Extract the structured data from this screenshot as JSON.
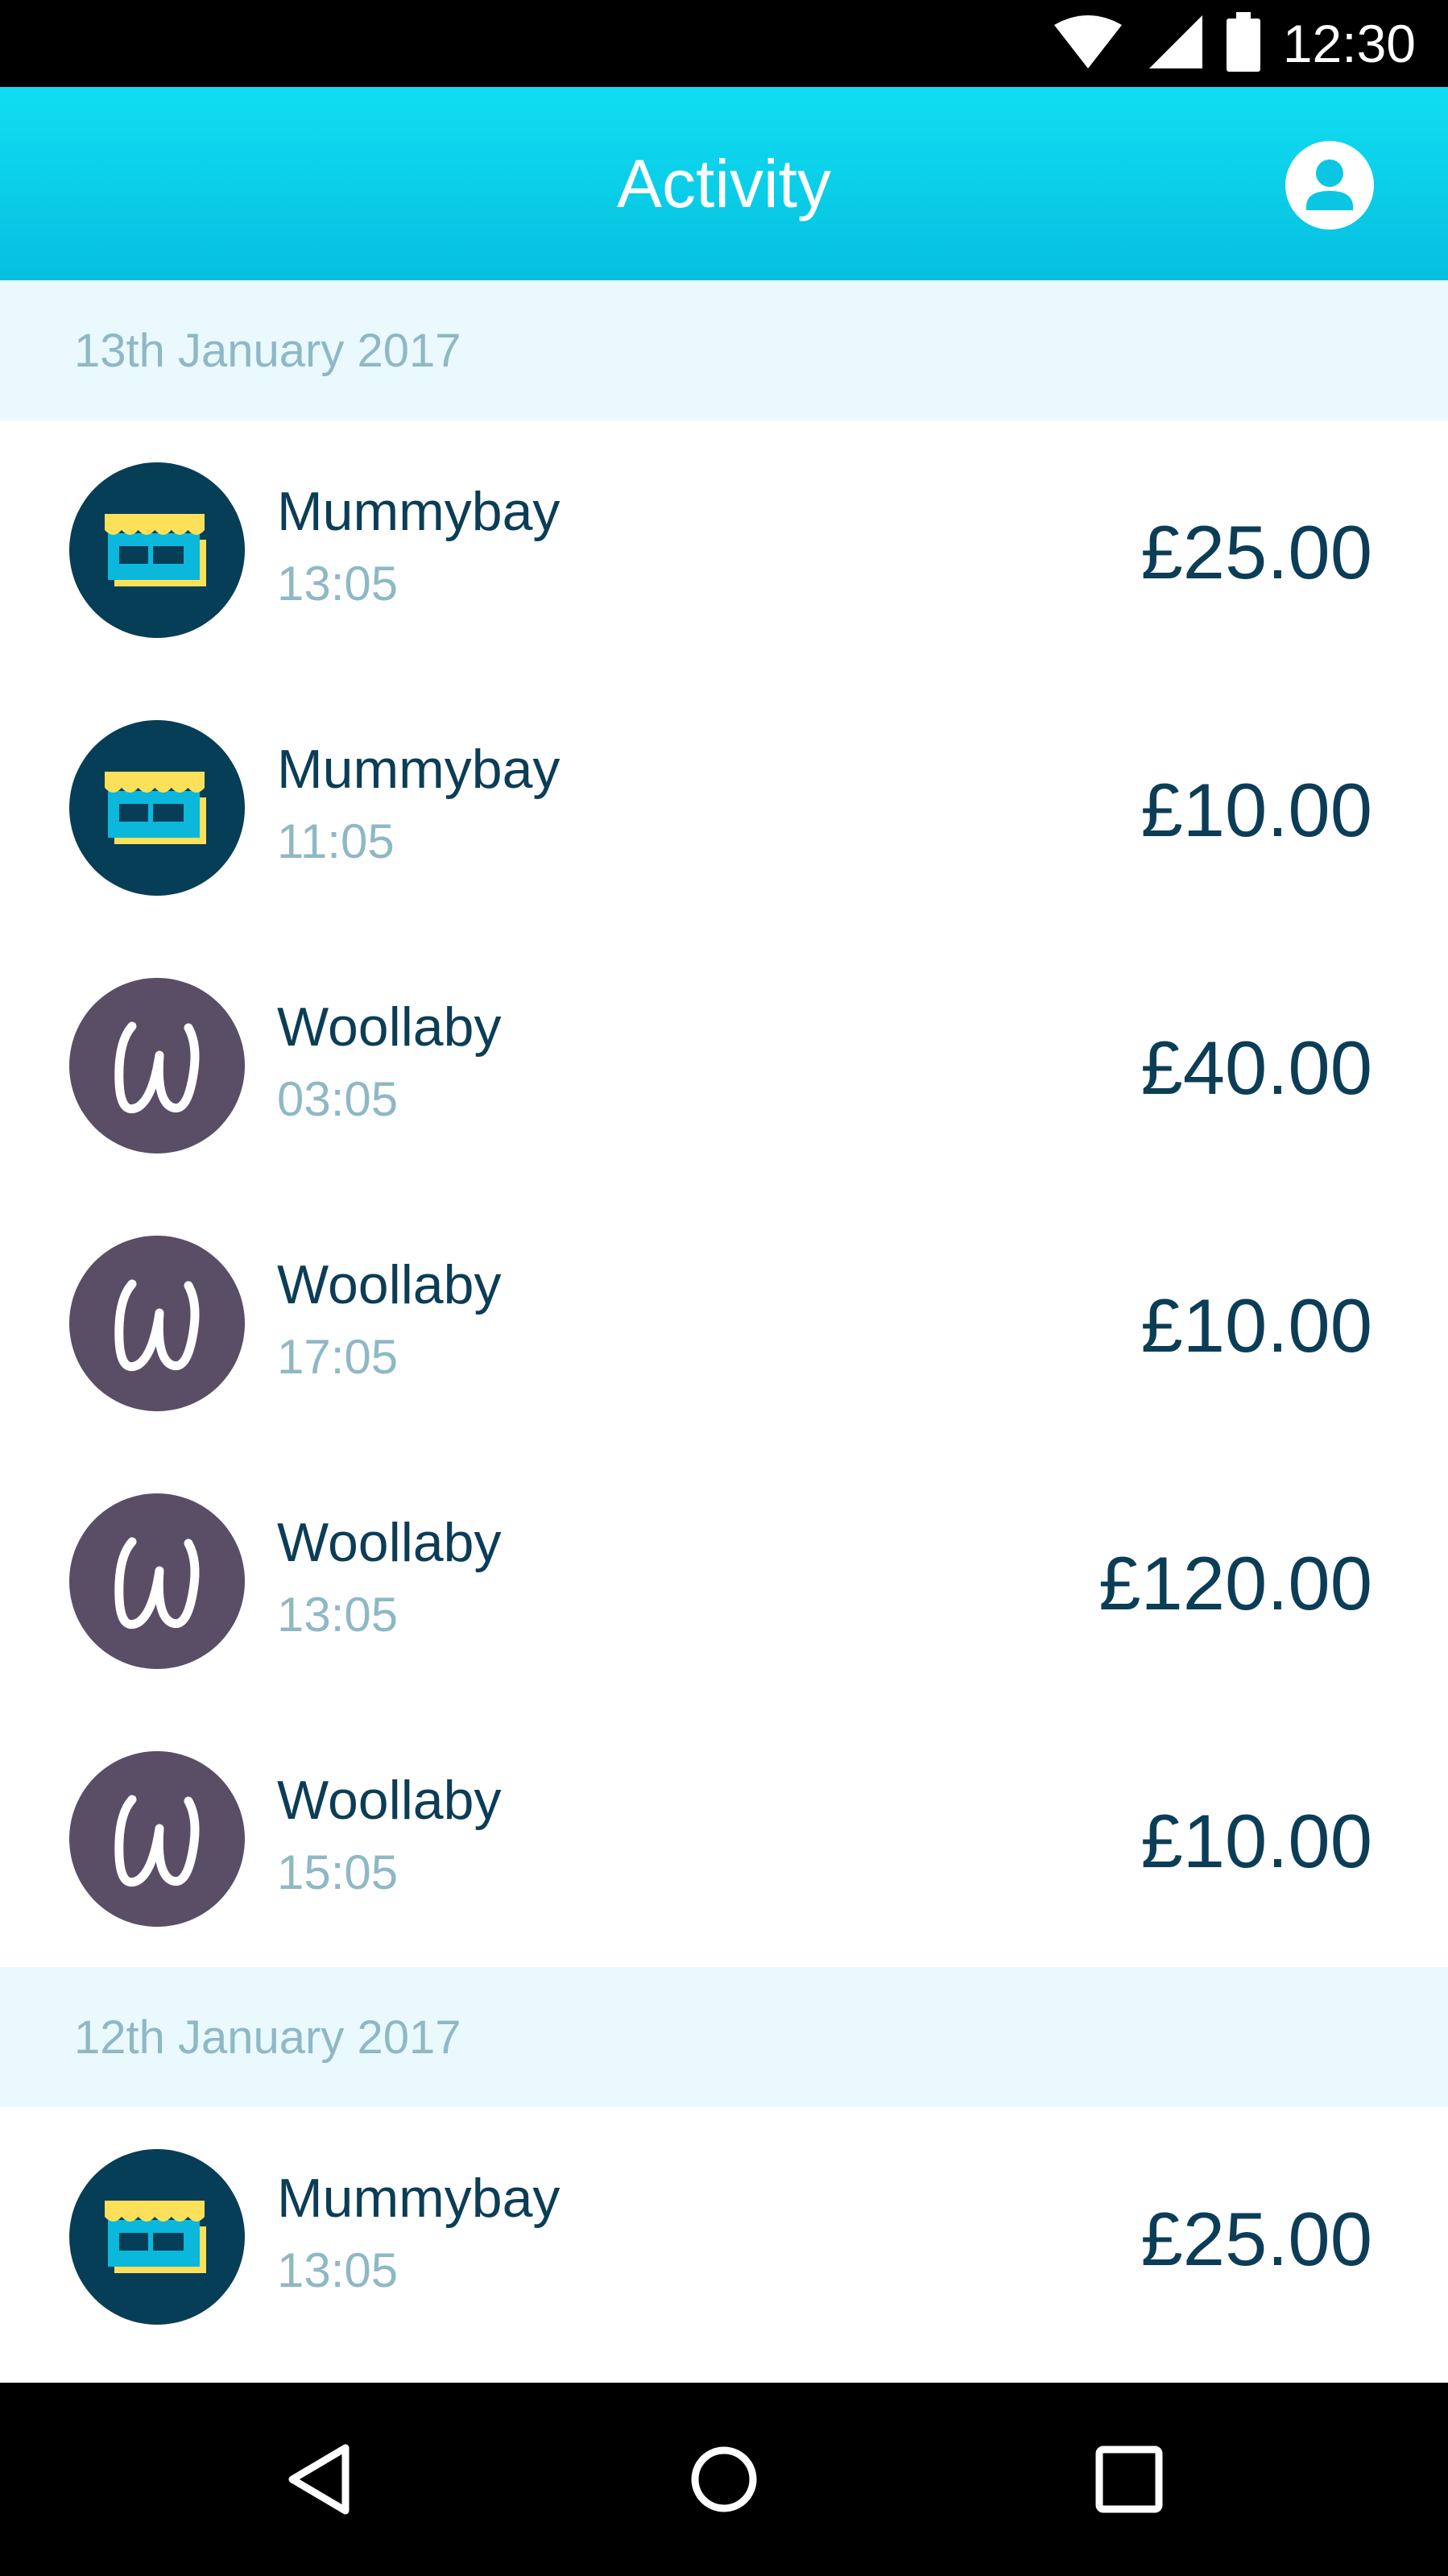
{
  "status_bar": {
    "time": "12:30",
    "icons": [
      "wifi-icon",
      "cell-signal-icon",
      "battery-icon"
    ]
  },
  "app_bar": {
    "title": "Activity",
    "account_icon": "account-icon"
  },
  "colors": {
    "app_bar_top": "#10def2",
    "app_bar_bottom": "#06bfdf",
    "date_header_bg": "#eaf9fd",
    "date_text": "#8fb8c6",
    "primary_text": "#0c3d56",
    "shop_avatar_bg": "#063e57",
    "wool_avatar_bg": "#5a4e66",
    "shop_awning": "#fde05a"
  },
  "groups": [
    {
      "date": "13th January 2017",
      "transactions": [
        {
          "merchant": "Mummybay",
          "time": "13:05",
          "amount": "£25.00",
          "icon": "shop-icon"
        },
        {
          "merchant": "Mummybay",
          "time": "11:05",
          "amount": "£10.00",
          "icon": "shop-icon"
        },
        {
          "merchant": "Woollaby",
          "time": "03:05",
          "amount": "£40.00",
          "icon": "woollaby-logo"
        },
        {
          "merchant": "Woollaby",
          "time": "17:05",
          "amount": "£10.00",
          "icon": "woollaby-logo"
        },
        {
          "merchant": "Woollaby",
          "time": "13:05",
          "amount": "£120.00",
          "icon": "woollaby-logo"
        },
        {
          "merchant": "Woollaby",
          "time": "15:05",
          "amount": "£10.00",
          "icon": "woollaby-logo"
        }
      ]
    },
    {
      "date": "12th January 2017",
      "transactions": [
        {
          "merchant": "Mummybay",
          "time": "13:05",
          "amount": "£25.00",
          "icon": "shop-icon"
        }
      ]
    }
  ],
  "nav_bar": {
    "icons": [
      "back-icon",
      "home-icon",
      "recents-icon"
    ]
  }
}
